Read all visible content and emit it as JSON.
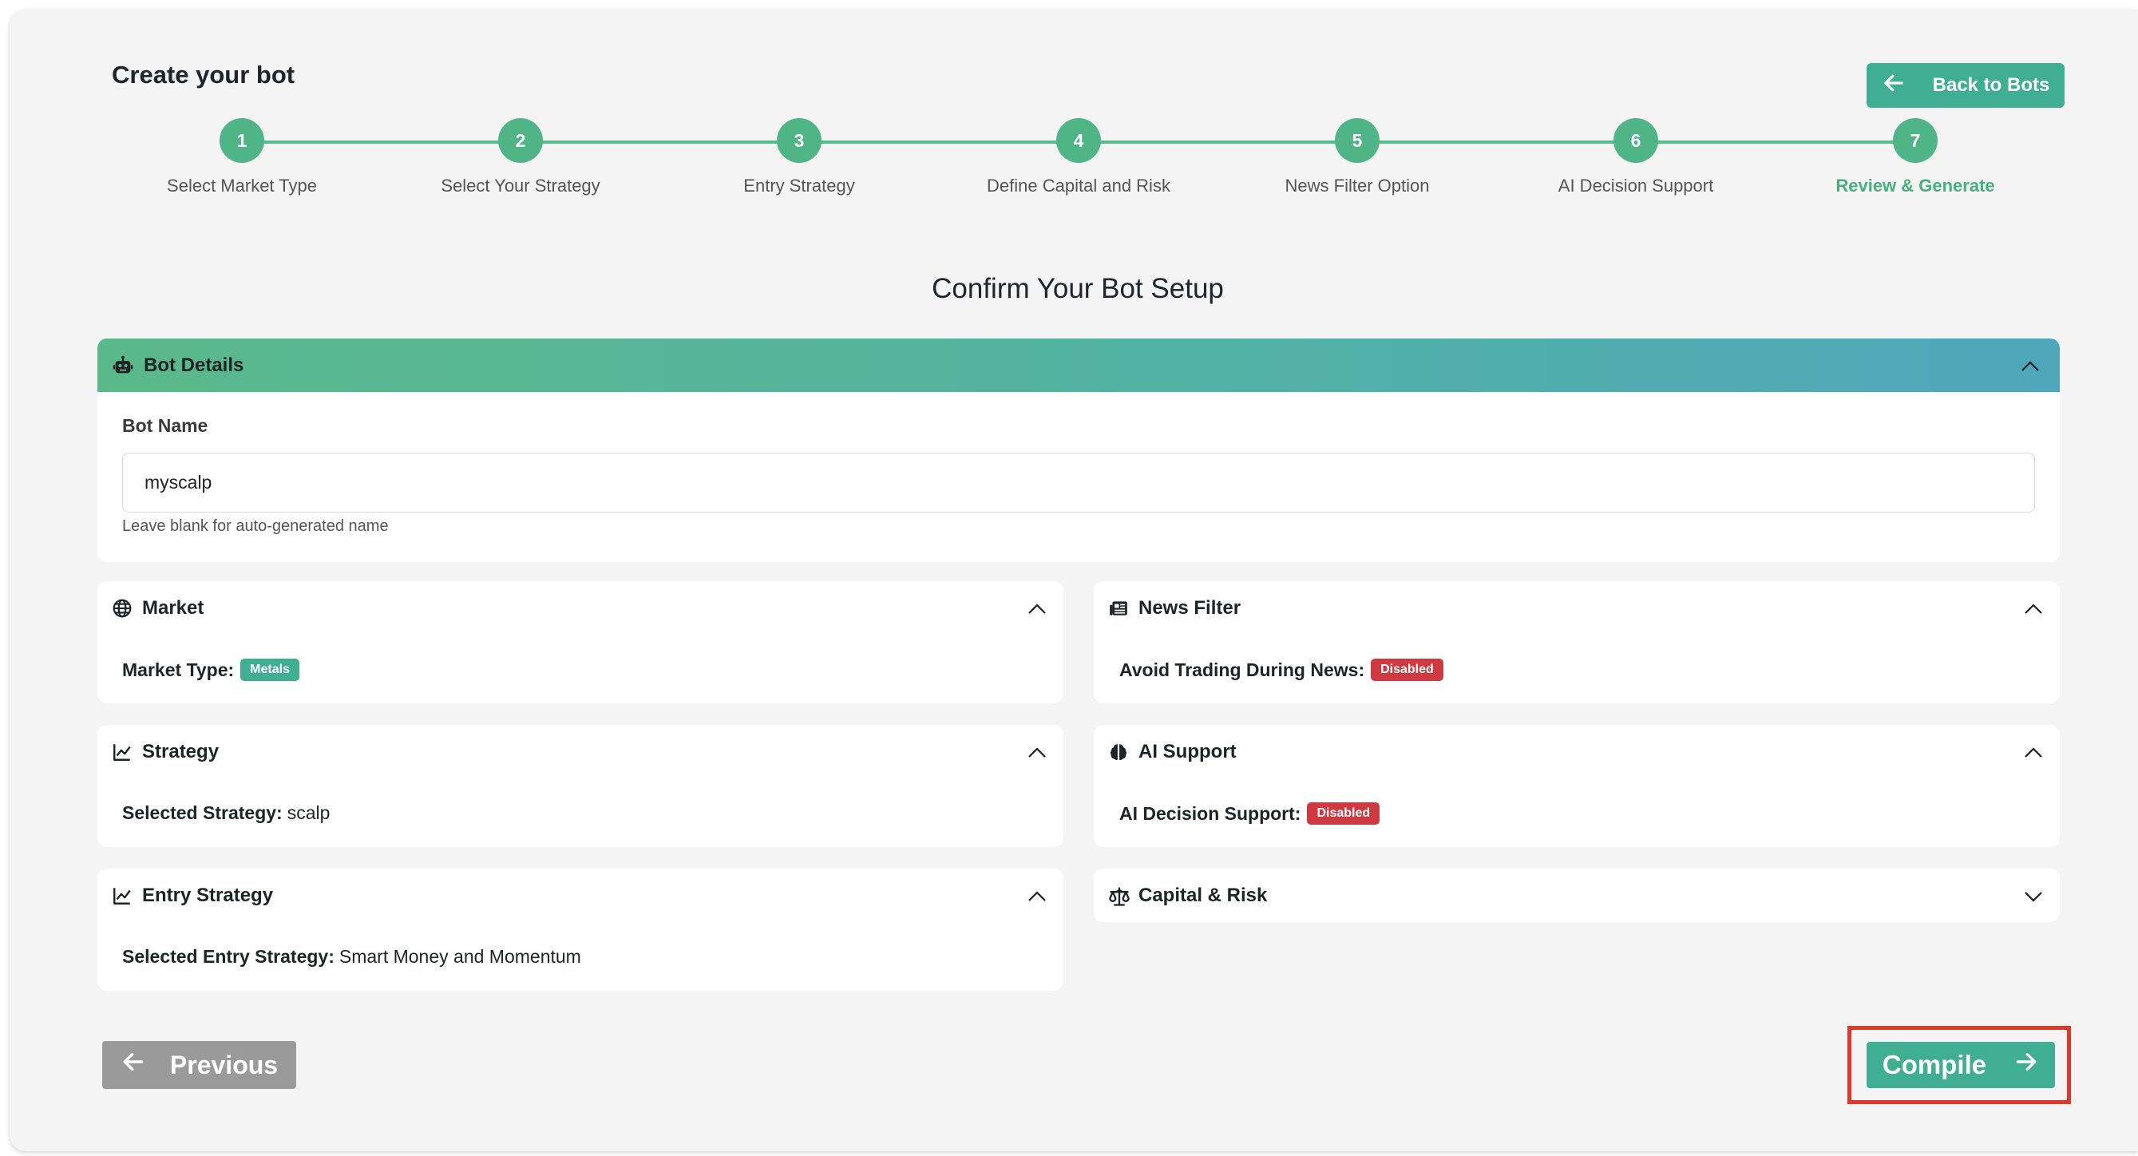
{
  "header": {
    "title": "Create your bot",
    "back_button": "Back to Bots"
  },
  "stepper": {
    "steps": [
      {
        "number": "1",
        "label": "Select Market Type"
      },
      {
        "number": "2",
        "label": "Select Your Strategy"
      },
      {
        "number": "3",
        "label": "Entry Strategy"
      },
      {
        "number": "4",
        "label": "Define Capital and Risk"
      },
      {
        "number": "5",
        "label": "News Filter Option"
      },
      {
        "number": "6",
        "label": "AI Decision Support"
      },
      {
        "number": "7",
        "label": "Review & Generate"
      }
    ],
    "active_step": 7
  },
  "section_title": "Confirm Your Bot Setup",
  "bot_details": {
    "header": "Bot Details",
    "name_label": "Bot Name",
    "name_value": "myscalp",
    "help_text": "Leave blank for auto-generated name"
  },
  "cards": {
    "market": {
      "title": "Market",
      "field_label": "Market Type:",
      "badge": "Metals"
    },
    "news_filter": {
      "title": "News Filter",
      "field_label": "Avoid Trading During News:",
      "badge": "Disabled"
    },
    "strategy": {
      "title": "Strategy",
      "field_label": "Selected Strategy:",
      "value": "scalp"
    },
    "ai_support": {
      "title": "AI Support",
      "field_label": "AI Decision Support:",
      "badge": "Disabled"
    },
    "entry_strategy": {
      "title": "Entry Strategy",
      "field_label": "Selected Entry Strategy:",
      "value": "Smart Money and Momentum"
    },
    "capital_risk": {
      "title": "Capital & Risk"
    }
  },
  "footer": {
    "previous_button": "Previous",
    "compile_button": "Compile"
  },
  "colors": {
    "accent": "#3fae92",
    "step": "#4fb586",
    "danger": "#cf3a42",
    "highlight_outline": "#e0392b",
    "disabled_button": "#9a9a9a"
  },
  "icons": {
    "back": "arrow-left-icon",
    "bot": "robot-icon",
    "market": "globe-icon",
    "news": "newspaper-icon",
    "strategy": "chart-line-icon",
    "ai": "brain-icon",
    "capital": "scale-icon",
    "next": "arrow-right-icon"
  }
}
